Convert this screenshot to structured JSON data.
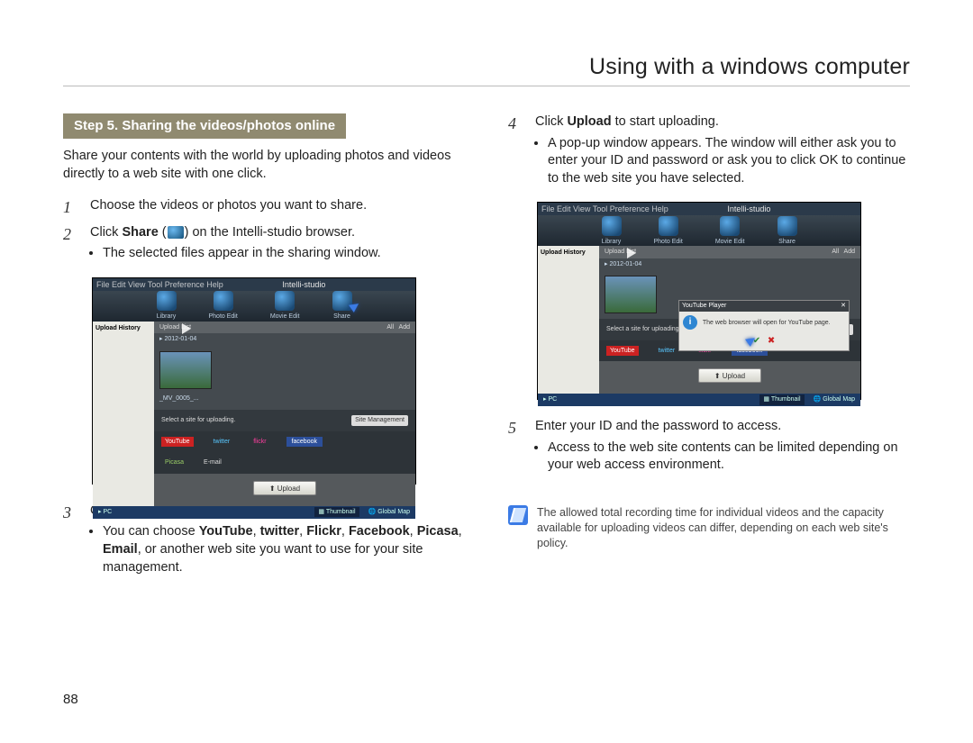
{
  "header": {
    "title": "Using with a windows computer"
  },
  "pagenum": "88",
  "step_banner": "Step 5. Sharing the videos/photos online",
  "intro": "Share your contents with the world by uploading photos and videos directly to a web site with one click.",
  "steps": {
    "s1": {
      "num": "1",
      "text": "Choose the videos or photos you want to share."
    },
    "s2": {
      "num": "2",
      "text_a": "Click ",
      "strong": "Share",
      "text_b": " (",
      "text_c": ") on the Intelli-studio browser.",
      "bullet1": "The selected files appear in the sharing window."
    },
    "s3": {
      "num": "3",
      "text": "Click the web site you would like to upload files to.",
      "bullet_a": "You can choose ",
      "b1": "YouTube",
      "b2": "twitter",
      "b3": "Flickr",
      "b4": "Facebook",
      "b5": "Picasa",
      "b6": "Email",
      "bullet_b": ", or another web site you want to use for your site management."
    },
    "s4": {
      "num": "4",
      "text_a": "Click ",
      "strong": "Upload",
      "text_b": " to start uploading.",
      "bullet1": "A pop-up window appears. The window will either ask you to enter your ID and password or ask you to click OK to continue to the web site you have selected."
    },
    "s5": {
      "num": "5",
      "text": "Enter your ID and the password to access.",
      "bullet1": "Access to the web site contents can be limited depending on your web access environment."
    }
  },
  "note": "The allowed total recording time for individual videos and the capacity available for uploading videos can differ, depending on each web site's policy.",
  "shot": {
    "app_title": "Intelli-studio",
    "menu": "File Edit View Tool Preference Help",
    "tabs": {
      "library": "Library",
      "photo": "Photo Edit",
      "movie": "Movie Edit",
      "share": "Share"
    },
    "side_header": "Upload History",
    "upload_list": "Upload List",
    "date": "2012-01-04",
    "filename": "_MV_0005_...",
    "select_site": "Select a site for uploading.",
    "site_mgmt": "Site Management",
    "upload_btn": "Upload",
    "bottom": {
      "pc": "PC",
      "thumbnail": "Thumbnail",
      "globalmap": "Global Map"
    },
    "popup_title": "YouTube Player",
    "popup_msg": "The web browser will open for YouTube page."
  }
}
